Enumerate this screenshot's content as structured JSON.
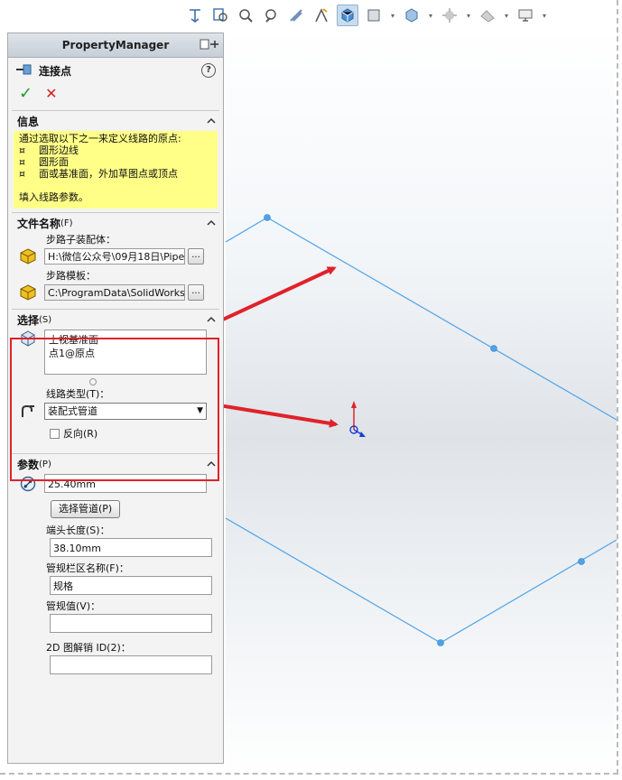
{
  "panel": {
    "header_title": "PropertyManager",
    "feature_title": "连接点",
    "help_glyph": "?"
  },
  "info": {
    "title": "信息",
    "intro": "通过选取以下之一来定义线路的原点:",
    "bullet_glyph": "¤",
    "items": [
      "圆形边线",
      "圆形面",
      "面或基准面，外加草图点或顶点"
    ],
    "footer": "填入线路参数。"
  },
  "filename": {
    "title": "文件名称",
    "shortcut": "(F)",
    "sub_assembly_label": "步路子装配体：",
    "sub_assembly_value": "H:\\微信公众号\\09月18日\\Pipe",
    "template_label": "步路模板：",
    "template_value": "C:\\ProgramData\\SolidWorks\\S",
    "browse_label": "..."
  },
  "selection": {
    "title": "选择",
    "shortcut": "(S)",
    "items": [
      "上视基准面",
      "点1@原点"
    ],
    "route_type_label": "线路类型(T)：",
    "route_type_value": "装配式管道",
    "reverse_label": "反向(R)"
  },
  "params": {
    "title": "参数",
    "shortcut": "(P)",
    "diameter_value": "25.40mm",
    "select_pipe_label": "选择管道(P)",
    "stub_length_label": "端头长度(S)：",
    "stub_length_value": "38.10mm",
    "spec_col_label": "管规栏区名称(F)：",
    "spec_col_value": "规格",
    "spec_value_label": "管规值(V)：",
    "spec_value_value": "",
    "bom_id_label": "2D 图解销 ID(2)：",
    "bom_id_value": ""
  },
  "colors": {
    "accent_red": "#e0222a",
    "plane_line": "#4da3e8",
    "info_bg": "#ffff88"
  },
  "toolbar_icons": [
    "view-orient-icon",
    "zoom-fit-icon",
    "zoom-area-icon",
    "previous-view-icon",
    "section-view-icon",
    "dynamic-annotation-icon",
    "view-orientation-icon",
    "display-style-icon",
    "hide-show-icon",
    "edit-appearance-icon",
    "apply-scene-icon",
    "view-settings-icon",
    "monitor-icon"
  ]
}
